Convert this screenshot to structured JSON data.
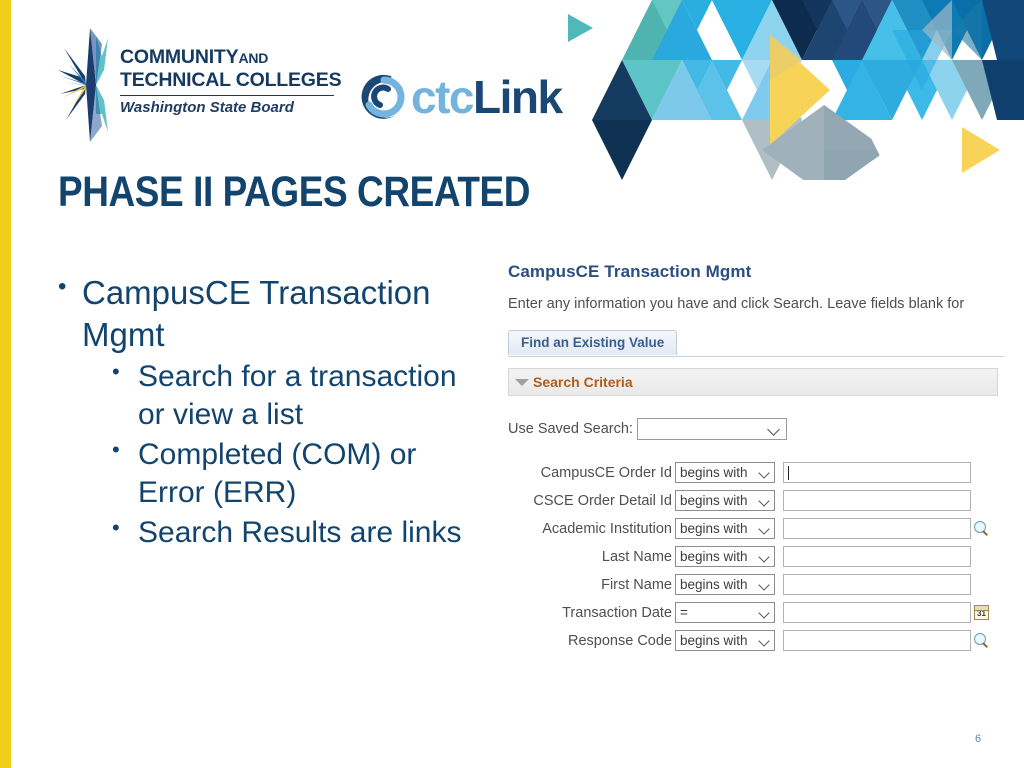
{
  "theme": {
    "accent_yellow": "#f2cd19",
    "navy": "#12446e",
    "logo_light_blue": "#74b3dd",
    "logo_dark_blue": "#1b4775",
    "peoplesoft_title_blue": "#2b4f81",
    "criteria_orange": "#b35c19"
  },
  "header": {
    "sbctc_logo": {
      "line1_main": "COMMUNITY",
      "line1_small": "AND",
      "line2": "TECHNICAL COLLEGES",
      "line3": "Washington State Board"
    },
    "ctclink_logo": {
      "part1": "ctc",
      "part2": "Link"
    }
  },
  "slide": {
    "title": "PHASE II PAGES CREATED",
    "page_number": "6",
    "bullets": [
      {
        "level": 1,
        "text": "CampusCE Transaction Mgmt"
      },
      {
        "level": 2,
        "text": "Search for a transaction or view a list"
      },
      {
        "level": 2,
        "text": "Completed (COM) or Error (ERR)"
      },
      {
        "level": 2,
        "text": "Search Results are links"
      }
    ]
  },
  "peoplesoft": {
    "page_title": "CampusCE Transaction Mgmt",
    "instructions": "Enter any information you have and click Search. Leave fields blank for",
    "tab_label": "Find an Existing Value",
    "section_label": "Search Criteria",
    "saved_search": {
      "label": "Use Saved Search:",
      "value": "",
      "options": []
    },
    "search_fields": [
      {
        "label": "CampusCE Order Id",
        "operator": "begins with",
        "value": "",
        "icon": "none",
        "focused": true
      },
      {
        "label": "CSCE Order Detail Id",
        "operator": "begins with",
        "value": "",
        "icon": "none",
        "focused": false
      },
      {
        "label": "Academic Institution",
        "operator": "begins with",
        "value": "",
        "icon": "search-icon",
        "focused": false
      },
      {
        "label": "Last Name",
        "operator": "begins with",
        "value": "",
        "icon": "none",
        "focused": false
      },
      {
        "label": "First Name",
        "operator": "begins with",
        "value": "",
        "icon": "none",
        "focused": false
      },
      {
        "label": "Transaction Date",
        "operator": "=",
        "value": "",
        "icon": "calendar-icon",
        "focused": false
      },
      {
        "label": "Response Code",
        "operator": "begins with",
        "value": "",
        "icon": "search-icon",
        "focused": false
      }
    ],
    "calendar_icon_day": "31"
  }
}
